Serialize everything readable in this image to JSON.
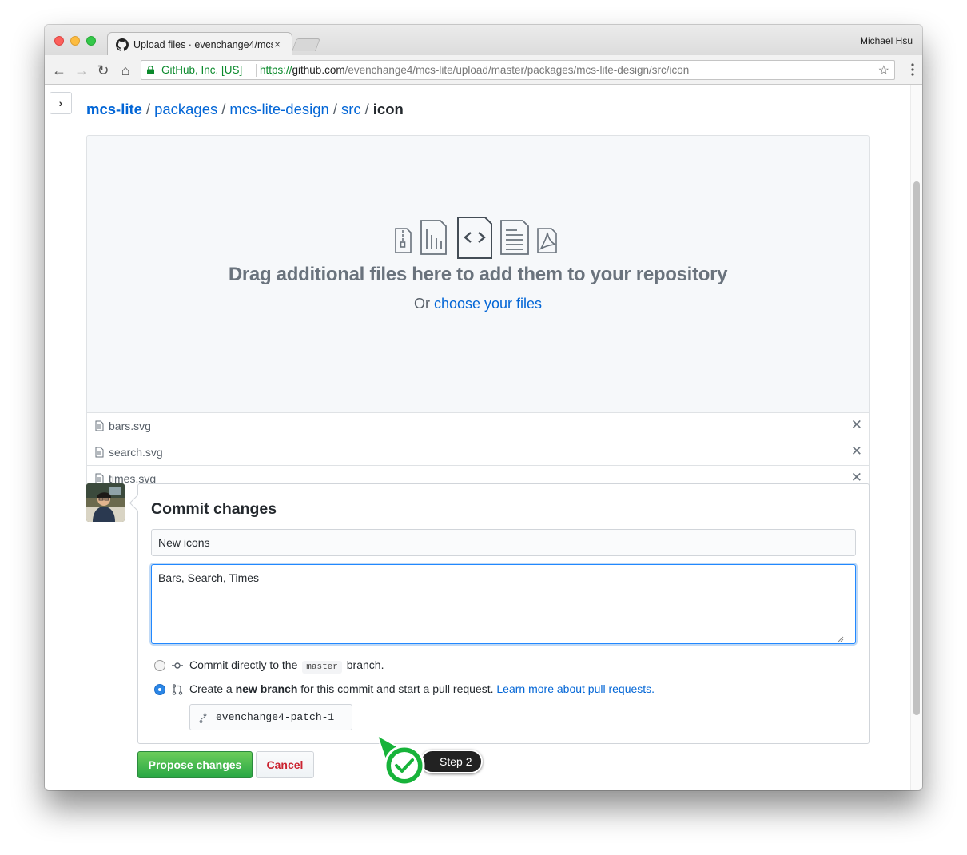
{
  "browser": {
    "tab_title": "Upload files · evenchange4/mcs-lite",
    "tab_close": "×",
    "profile_name": "Michael Hsu",
    "ev_label": "GitHub, Inc. [US]",
    "url_scheme": "https://",
    "url_host": "github.com",
    "url_path": "/evenchange4/mcs-lite/upload/master/packages/mcs-lite-design/src/icon",
    "nav": {
      "back": "←",
      "forward": "→",
      "reload": "↻",
      "home": "⌂",
      "star": "☆"
    }
  },
  "sidebar_toggle": "›",
  "breadcrumb": {
    "items": [
      "mcs-lite",
      "packages",
      "mcs-lite-design",
      "src"
    ],
    "separator": "/",
    "current": "icon"
  },
  "dropzone": {
    "heading": "Drag additional files here to add them to your repository",
    "sub_prefix": "Or ",
    "sub_link": "choose your files"
  },
  "files": [
    {
      "name": "bars.svg"
    },
    {
      "name": "search.svg"
    },
    {
      "name": "times.svg"
    }
  ],
  "remove_glyph": "✕",
  "commit": {
    "title": "Commit changes",
    "summary_value": "New icons",
    "description_value": "Bars, Search, Times",
    "option_direct": {
      "prefix": "Commit directly to the",
      "branch": "master",
      "suffix": "branch."
    },
    "option_new_branch": {
      "prefix": "Create a",
      "bold": "new branch",
      "middle": "for this commit and start a pull request.",
      "link": "Learn more about pull requests."
    },
    "branch_name": "evenchange4-patch-1",
    "selected_option": "new_branch"
  },
  "buttons": {
    "propose": "Propose changes",
    "cancel": "Cancel"
  },
  "annotation": {
    "step_label": "Step 2"
  },
  "colors": {
    "link": "#0366d6",
    "primary_button": "#28a745",
    "cancel_text": "#cb2431",
    "step_marker": "#17b33a"
  }
}
